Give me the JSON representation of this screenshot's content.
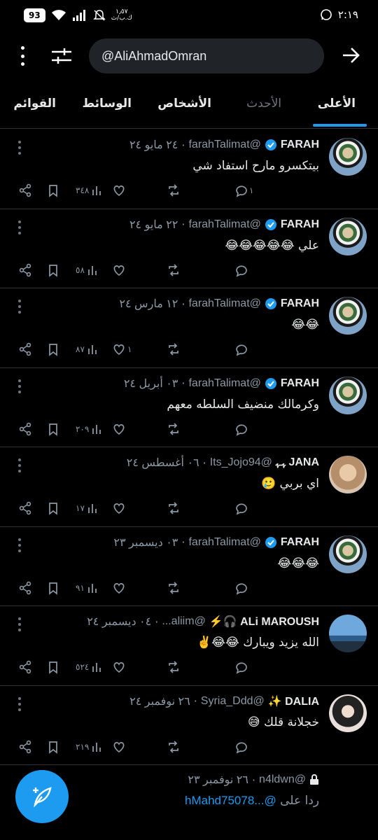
{
  "status_bar": {
    "battery": "93",
    "speed": "١٫٥٧\nك.ب/ث",
    "time": "٢:١٩"
  },
  "search": {
    "value": "@AliAhmadOmran"
  },
  "tabs": [
    {
      "label": "الأعلى",
      "active": true
    },
    {
      "label": "الأحدث",
      "active": false
    },
    {
      "label": "الأشخاص",
      "active": false
    },
    {
      "label": "الوسائط",
      "active": false
    },
    {
      "label": "القوائم",
      "active": false
    }
  ],
  "tweets": [
    {
      "name": "FARAH",
      "verified": true,
      "handle": "@farahTalimat",
      "date": "٢٤ مايو ٢٤",
      "text": "بيتكسرو مارح استفاد شي",
      "replies": "١",
      "views": "٣٤٨",
      "avatar": "farah"
    },
    {
      "name": "FARAH",
      "verified": true,
      "handle": "@farahTalimat",
      "date": "٢٢ مايو ٢٤",
      "text": "علي 😂😂😂😂😂",
      "replies": "",
      "views": "٥٨",
      "avatar": "farah"
    },
    {
      "name": "FARAH",
      "verified": true,
      "handle": "@farahTalimat",
      "date": "١٢ مارس ٢٤",
      "text": "😂😂",
      "replies": "",
      "likes": "١",
      "views": "٨٧",
      "avatar": "farah"
    },
    {
      "name": "FARAH",
      "verified": true,
      "handle": "@farahTalimat",
      "date": "٠٣ أبريل ٢٤",
      "text": "وكرمالك منضيف السلطه معهم",
      "replies": "",
      "views": "٢٠٩",
      "avatar": "farah"
    },
    {
      "name": "JANA ﮩـﮩ",
      "verified": false,
      "handle": "@Its_Jojo94",
      "date": "٠٦ أغسطس ٢٤",
      "text": "اي بربي 🥲",
      "replies": "",
      "views": "١٧",
      "avatar": "jana"
    },
    {
      "name": "FARAH",
      "verified": true,
      "handle": "@farahTalimat",
      "date": "٠٣ ديسمبر ٢٣",
      "text": "😂😂😂",
      "replies": "",
      "views": "٩١",
      "avatar": "farah"
    },
    {
      "name": "ALi MAROUSH 🎧⚡",
      "verified": false,
      "handle": "@aliim...",
      "date": "٠٤ ديسمبر ٢٤",
      "text": "الله يزيد ويبارك 😂😂✌️",
      "replies": "",
      "views": "٥٢٤",
      "avatar": "ali"
    },
    {
      "name": "DALIA ✨",
      "verified": false,
      "handle": "@Syria_Ddd",
      "date": "٢٦ نوفمبر ٢٤",
      "text": "خجلانة قلك 😅",
      "replies": "",
      "views": "٢١٩",
      "avatar": "dalia"
    }
  ],
  "last_tweet": {
    "handle": "@n4ldwn",
    "date": "٢٦ نوفمبر ٢٣",
    "reply_prefix": "ردا على",
    "reply_mention": "@...hMahd75078"
  },
  "colors": {
    "accent": "#1d9bf0",
    "bg": "#000000",
    "muted": "#8b98a5"
  }
}
